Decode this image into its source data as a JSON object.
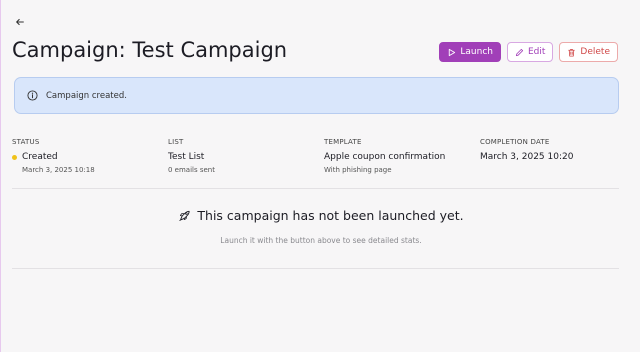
{
  "header": {
    "title": "Campaign: Test Campaign",
    "buttons": {
      "launch": "Launch",
      "edit": "Edit",
      "delete": "Delete"
    }
  },
  "alert": {
    "message": "Campaign created."
  },
  "stats": {
    "status": {
      "label": "STATUS",
      "value": "Created",
      "sub": "March 3, 2025 10:18"
    },
    "list": {
      "label": "LIST",
      "value": "Test List",
      "sub": "0 emails sent"
    },
    "template": {
      "label": "TEMPLATE",
      "value": "Apple coupon confirmation",
      "sub": "With phishing page"
    },
    "completion": {
      "label": "COMPLETION DATE",
      "value": "March 3, 2025 10:20"
    }
  },
  "empty_state": {
    "title": "This campaign has not been launched yet.",
    "subtitle": "Launch it with the button above to see detailed stats."
  },
  "colors": {
    "accent": "#a13fb8",
    "danger": "#d04848",
    "alert_bg": "#d9e6fb",
    "status_dot": "#f0c21a"
  },
  "icons": [
    "back-arrow-icon",
    "play-icon",
    "pencil-icon",
    "trash-icon",
    "info-icon",
    "rocket-icon"
  ]
}
